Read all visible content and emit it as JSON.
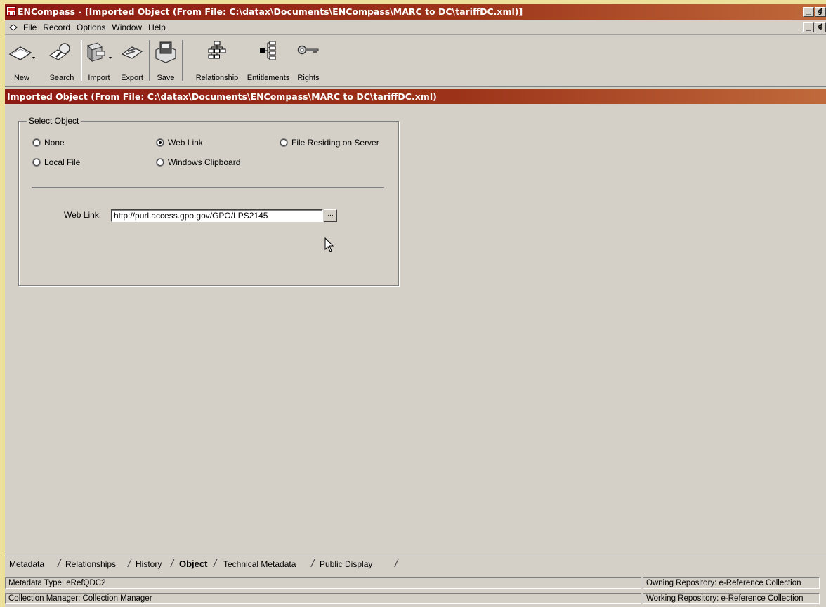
{
  "window": {
    "title": "ENCompass - [Imported Object (From File: C:\\datax\\Documents\\ENCompass\\MARC to DC\\tariffDC.xml)]",
    "caption_minimize": "_",
    "caption_restore": "ɠ"
  },
  "menu": {
    "items": [
      "File",
      "Record",
      "Options",
      "Window",
      "Help"
    ],
    "mdi_minimize": "_",
    "mdi_restore": "ɠ"
  },
  "toolbar": {
    "new": "New",
    "search": "Search",
    "import": "Import",
    "export": "Export",
    "save": "Save",
    "relationship": "Relationship",
    "entitlements": "Entitlements",
    "rights": "Rights"
  },
  "section": {
    "title": "Imported Object (From File: C:\\datax\\Documents\\ENCompass\\MARC to DC\\tariffDC.xml)"
  },
  "select_object": {
    "legend": "Select Object",
    "options": [
      {
        "label": "None",
        "selected": false
      },
      {
        "label": "Web Link",
        "selected": true
      },
      {
        "label": "File Residing on Server",
        "selected": false
      },
      {
        "label": "Local File",
        "selected": false
      },
      {
        "label": "Windows Clipboard",
        "selected": false
      }
    ],
    "web_link_label": "Web Link:",
    "web_link_value": "http://purl.access.gpo.gov/GPO/LPS2145",
    "browse_label": "..."
  },
  "tabs": [
    "Metadata",
    "Relationships",
    "History",
    "Object",
    "Technical Metadata",
    "Public Display"
  ],
  "active_tab": "Object",
  "status": {
    "metadata_type": "Metadata Type: eRefQDC2",
    "owning_repository": "Owning Repository:  e-Reference Collection",
    "collection_manager": "Collection Manager:  Collection Manager",
    "working_repository": "Working Repository:  e-Reference Collection"
  },
  "colors": {
    "title_bar": "#8e1a14",
    "face": "#d4d0c8",
    "desktop": "#ece09a"
  }
}
